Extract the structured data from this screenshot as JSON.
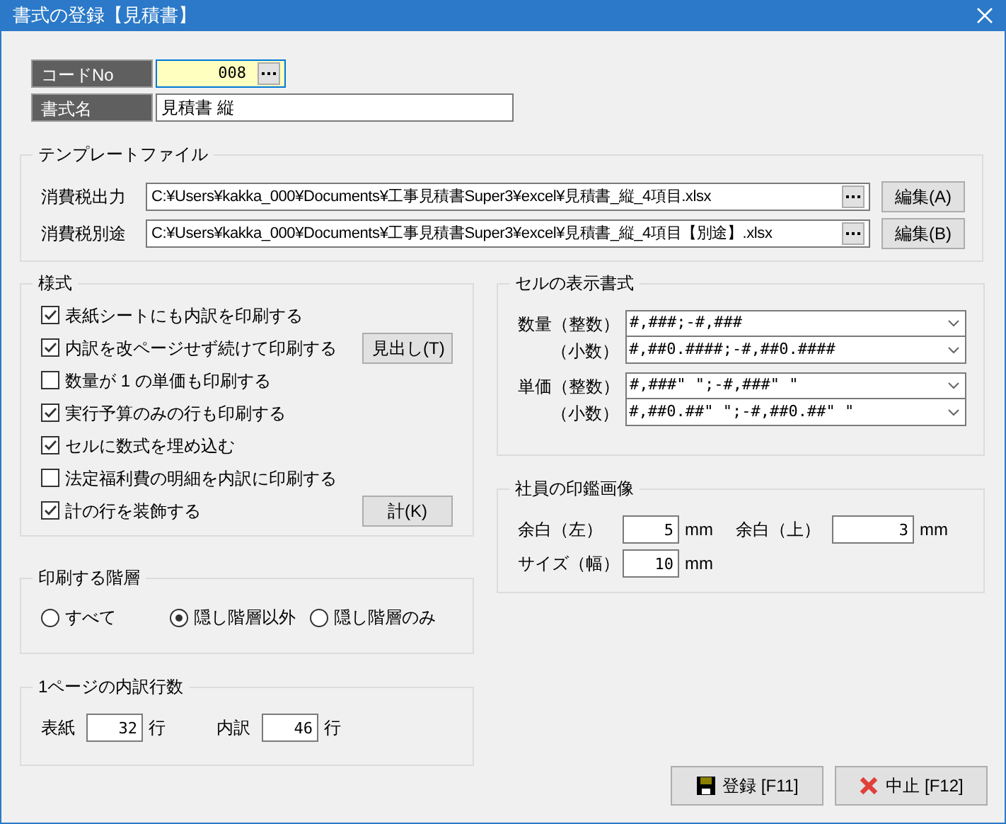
{
  "window": {
    "title": "書式の登録【見積書】"
  },
  "code": {
    "label": "コードNo",
    "value": "008"
  },
  "format_name": {
    "label": "書式名",
    "value": "見積書 縦"
  },
  "template_file": {
    "title": "テンプレートファイル",
    "rows": [
      {
        "label": "消費税出力",
        "path": "C:¥Users¥kakka_000¥Documents¥工事見積書Super3¥excel¥見積書_縦_4項目.xlsx",
        "button": "編集(A)"
      },
      {
        "label": "消費税別途",
        "path": "C:¥Users¥kakka_000¥Documents¥工事見積書Super3¥excel¥見積書_縦_4項目【別途】.xlsx",
        "button": "編集(B)"
      }
    ]
  },
  "style": {
    "title": "様式",
    "options": [
      {
        "label": "表紙シートにも内訳を印刷する",
        "checked": true
      },
      {
        "label": "内訳を改ページせず続けて印刷する",
        "checked": true,
        "button": "見出し(T)"
      },
      {
        "label": "数量が 1 の単価も印刷する",
        "checked": false
      },
      {
        "label": "実行予算のみの行も印刷する",
        "checked": true
      },
      {
        "label": "セルに数式を埋め込む",
        "checked": true
      },
      {
        "label": "法定福利費の明細を内訳に印刷する",
        "checked": false
      },
      {
        "label": "計の行を装飾する",
        "checked": true,
        "button": "計(K)"
      }
    ]
  },
  "print_level": {
    "title": "印刷する階層",
    "options": [
      {
        "label": "すべて",
        "selected": false
      },
      {
        "label": "隠し階層以外",
        "selected": true
      },
      {
        "label": "隠し階層のみ",
        "selected": false
      }
    ]
  },
  "rows_per_page": {
    "title": "1ページの内訳行数",
    "fields": [
      {
        "label": "表紙",
        "value": "32",
        "unit": "行"
      },
      {
        "label": "内訳",
        "value": "46",
        "unit": "行"
      }
    ]
  },
  "cell_format": {
    "title": "セルの表示書式",
    "groups": [
      {
        "rows": [
          {
            "label": "数量（整数）",
            "value": "#,###;-#,###"
          },
          {
            "label": "（小数）",
            "value": "#,##0.####;-#,##0.####"
          }
        ]
      },
      {
        "rows": [
          {
            "label": "単価（整数）",
            "value": "#,###\" \";-#,###\" \""
          },
          {
            "label": "（小数）",
            "value": "#,##0.##\" \";-#,##0.##\" \""
          }
        ]
      }
    ]
  },
  "seal_image": {
    "title": "社員の印鑑画像",
    "fields": [
      {
        "label": "余白（左）",
        "value": "5",
        "unit": "mm"
      },
      {
        "label": "余白（上）",
        "value": "3",
        "unit": "mm"
      },
      {
        "label": "サイズ（幅）",
        "value": "10",
        "unit": "mm"
      }
    ]
  },
  "buttons": [
    {
      "label": "登録 [F11]",
      "kind": "save"
    },
    {
      "label": "中止 [F12]",
      "kind": "cancel"
    }
  ]
}
